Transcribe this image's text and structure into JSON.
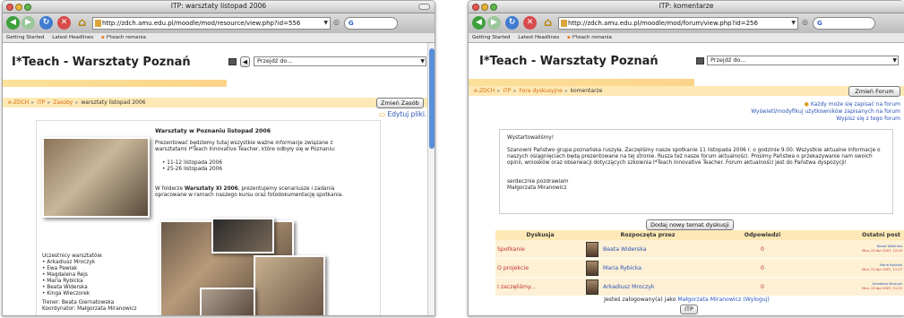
{
  "left_window": {
    "title": "ITP: warsztaty listopad 2006",
    "url": "http://zdch.amu.edu.pl/moodle/mod/resource/view.php?id=556",
    "search_placeholder": "G",
    "bookmarks": [
      "Getting Started",
      "Latest Headlines",
      "I*teach romania"
    ],
    "site_title": "I*Teach - Warsztaty Poznań",
    "jump_label": "Przejdź do...",
    "breadcrumb": [
      "e-ZDCH",
      "ITP",
      "Zasoby",
      "warsztaty listopad 2006"
    ],
    "update_button": "Zmień Zasób",
    "edit_link": "Edytuj pliki...",
    "content": {
      "heading": "Warsztaty w Poznaniu listopad 2006",
      "intro": "Prezentować będziemy tutaj wszystkie ważne informacje związane z warsztatami I*Teach Innovative Teacher, które odbyły się w Poznaniu:",
      "dates": [
        "11-12 listopada 2006",
        "25-26 listopada 2006"
      ],
      "folder_pre": "W folderze",
      "folder_name": "Warsztaty XI 2006",
      "folder_post": ", prezentujemy scenariusze i zadania opracowane w ramach naszego kursu oraz fotodokumentację spotkania.",
      "participants_label": "Uczestnicy warsztatów:",
      "participants": [
        "Arkadiusz Mroczyk",
        "Ewa Pawlak",
        "Magdalena Rejs",
        "Maria Rybicka",
        "Beata Widerska",
        "Kinga Wieczorek"
      ],
      "trainer": "Trener: Beata Giernatowska",
      "coordinator": "Koordynator: Małgorzata Miranowicz"
    }
  },
  "right_window": {
    "title": "ITP: komentarze",
    "url": "http://zdch.amu.edu.pl/moodle/mod/forum/view.php?id=256",
    "search_placeholder": "G",
    "bookmarks": [
      "Getting Started",
      "Latest Headlines",
      "I*teach romania"
    ],
    "site_title": "I*Teach - Warsztaty Poznań",
    "jump_label": "Przejdź do...",
    "breadcrumb": [
      "e-ZDCH",
      "ITP",
      "Fora dyskusyjne",
      "komentarze"
    ],
    "update_button": "Zmień Forum",
    "subscribe_links": [
      "Każdy może się zapisać na forum",
      "Wyświetl/modyfikuj użytkowników zapisanych na forum",
      "Wypisz się z tego forum"
    ],
    "intro": {
      "greeting": "Wystartowaliśmy!",
      "body": "Szanowni Państwo grupa poznańska ruszyła. Zaczęliśmy nasze spotkanie 11 listopada 2006 r. o godzinie 9.00. Wszystkie aktualne informacje o naszych osiągnięciach będą prezentowane na tej stronie. Rusza też nasze forum aktualności. Prosimy Państwa o przekazywanie nam swoich opinii, wniosków oraz obserwacji dotyczących szkolenia I*Teach Innovative Teacher. Forum aktualności jest do Państwa dyspozycji!",
      "closing": "serdecznie pozdrawiam",
      "signature": "Małgorzata Miranowicz"
    },
    "add_topic_button": "Dodaj nowy temat dyskusji",
    "table": {
      "headers": [
        "Dyskusja",
        "Rozpoczęta przez",
        "Odpowiedzi",
        "Ostatni post"
      ],
      "rows": [
        {
          "topic": "Spotkanie",
          "author": "Beata Widerska",
          "replies": "0",
          "last_name": "Beata Widerska",
          "last_date": "Mon, 23 Apr 2007, 12:03"
        },
        {
          "topic": "O projekcie",
          "author": "Maria Rybicka",
          "replies": "0",
          "last_name": "Maria Rybicka",
          "last_date": "Mon, 23 Apr 2007, 11:27"
        },
        {
          "topic": "I zaczęliśmy...",
          "author": "Arkadiusz Mroczyk",
          "replies": "0",
          "last_name": "Arkadiusz Mroczyk",
          "last_date": "Mon, 23 Apr 2007, 11:22"
        }
      ]
    },
    "logged_in_pre": "Jesteś zalogowany(a) jako",
    "logged_in_user": "Małgorzata Miranowicz",
    "logout": "(Wyloguj)",
    "footer_button": "ITP"
  },
  "colors": {
    "accent": "#fee9b6",
    "link": "#2b53b6",
    "breadcrumb": "#d46d0e",
    "topic": "#c03030"
  }
}
